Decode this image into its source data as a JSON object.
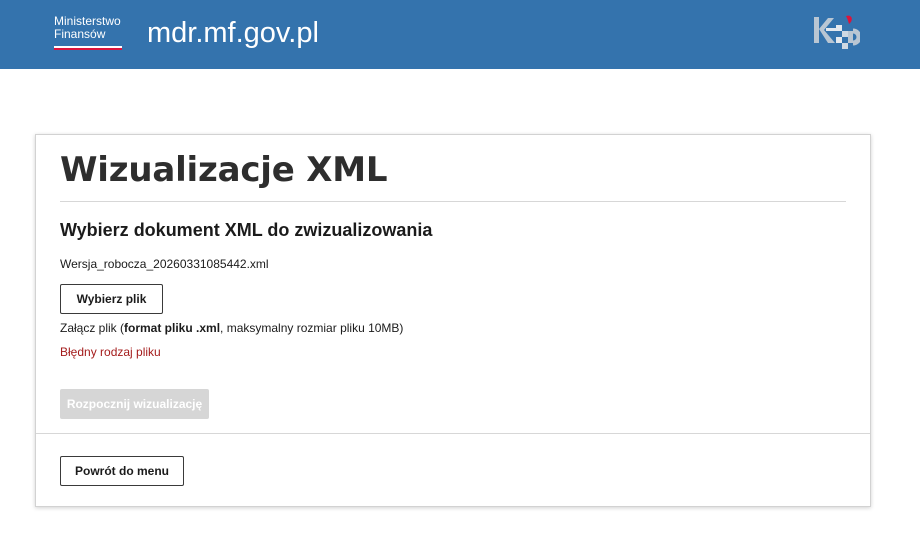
{
  "header": {
    "ministry_line1": "Ministerstwo",
    "ministry_line2": "Finansów",
    "site_title": "mdr.mf.gov.pl",
    "background_color": "#3473ad",
    "logo_icon": "kas-logo-icon"
  },
  "main": {
    "page_title": "Wizualizacje XML",
    "section_heading": "Wybierz dokument XML do zwizualizowania",
    "selected_file": "Wersja_robocza_20260331085442.xml",
    "choose_file_label": "Wybierz plik",
    "hint_prefix": "Załącz plik (",
    "hint_bold": "format pliku .xml",
    "hint_suffix": ", maksymalny rozmiar pliku 10MB)",
    "error_message": "Błędny rodzaj pliku",
    "error_color": "#a41c1c",
    "start_label": "Rozpocznij wizualizację",
    "start_disabled": true,
    "back_label": "Powrót do menu"
  }
}
